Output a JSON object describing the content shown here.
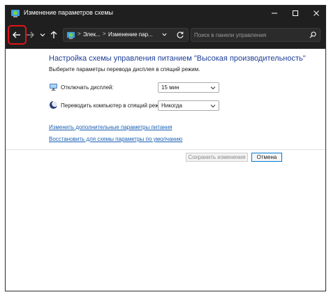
{
  "window": {
    "title": "Изменение параметров схемы",
    "controls": [
      "minimize-icon",
      "maximize-icon",
      "close-icon"
    ]
  },
  "toolbar": {
    "nav_buttons": [
      "back-arrow-icon",
      "forward-arrow-icon",
      "recent-dropdown-icon",
      "up-arrow-icon"
    ],
    "address": {
      "icon": "control-panel-icon",
      "crumbs": [
        "Элек...",
        "Изменение пар..."
      ],
      "separator": ">"
    },
    "search": {
      "placeholder": "Поиск в панели управления",
      "value": ""
    }
  },
  "main": {
    "heading": "Настройка схемы управления питанием \"Высокая производительность\"",
    "subheading": "Выберите параметры перевода дисплея в спящий режим.",
    "settings": [
      {
        "icon": "display-power-icon",
        "label": "Отключать дисплей:",
        "value": "15 мин"
      },
      {
        "icon": "sleep-moon-icon",
        "label": "Переводить компьютер в спящий режим:",
        "value": "Никогда"
      }
    ],
    "links": [
      "Изменить дополнительные параметры питания",
      "Восстановить для схемы параметры по умолчанию"
    ],
    "buttons": {
      "save": "Сохранить изменения",
      "cancel": "Отмена"
    }
  },
  "colors": {
    "titlebar": "#1f1f1f",
    "heading": "#1e3f97",
    "link": "#1a5fb4",
    "highlight": "#e0141a"
  }
}
